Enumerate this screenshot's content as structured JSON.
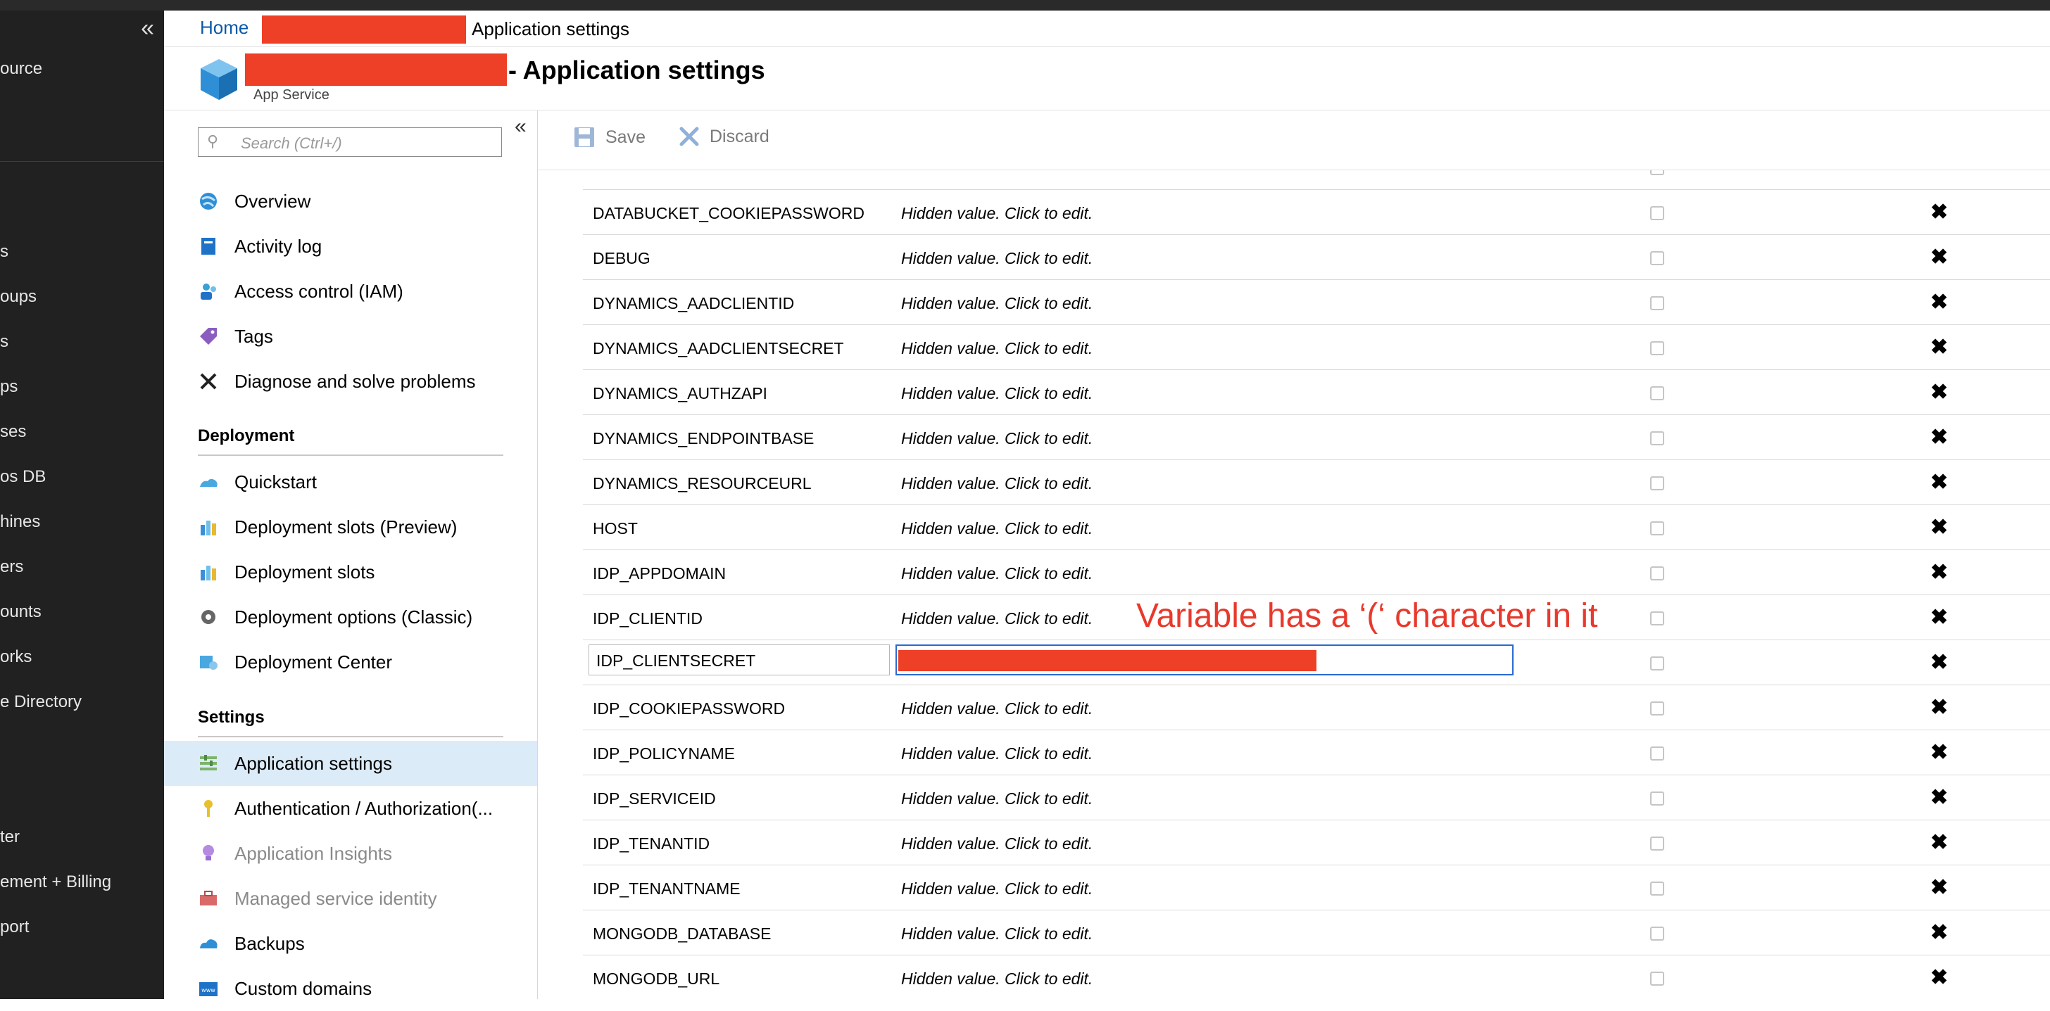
{
  "left_nav": {
    "items": [
      "ource",
      "s",
      "oups",
      "s",
      "ps",
      "ses",
      "os DB",
      "hines",
      "ers",
      "ounts",
      "orks",
      "e Directory",
      "ter",
      "ement + Billing",
      "port"
    ]
  },
  "breadcrumb": {
    "home": "Home",
    "current": "Application settings"
  },
  "header": {
    "title_suffix": "- Application settings",
    "subtitle": "App Service"
  },
  "search": {
    "placeholder": "Search (Ctrl+/)"
  },
  "menu": {
    "general": [
      {
        "label": "Overview",
        "icon": "overview-icon"
      },
      {
        "label": "Activity log",
        "icon": "activity-log-icon"
      },
      {
        "label": "Access control (IAM)",
        "icon": "iam-icon"
      },
      {
        "label": "Tags",
        "icon": "tag-icon"
      },
      {
        "label": "Diagnose and solve problems",
        "icon": "tools-icon"
      }
    ],
    "deployment_heading": "Deployment",
    "deployment": [
      {
        "label": "Quickstart",
        "icon": "quickstart-icon"
      },
      {
        "label": "Deployment slots (Preview)",
        "icon": "deployment-slots-icon"
      },
      {
        "label": "Deployment slots",
        "icon": "deployment-slots-icon"
      },
      {
        "label": "Deployment options (Classic)",
        "icon": "gear-icon"
      },
      {
        "label": "Deployment Center",
        "icon": "deployment-center-icon"
      }
    ],
    "settings_heading": "Settings",
    "settings": [
      {
        "label": "Application settings",
        "icon": "app-settings-icon",
        "active": true
      },
      {
        "label": "Authentication / Authorization(...",
        "icon": "key-icon"
      },
      {
        "label": "Application Insights",
        "icon": "insights-icon",
        "disabled": true
      },
      {
        "label": "Managed service identity",
        "icon": "toolbox-icon",
        "disabled": true
      },
      {
        "label": "Backups",
        "icon": "backup-cloud-icon"
      },
      {
        "label": "Custom domains",
        "icon": "www-icon"
      }
    ]
  },
  "toolbar": {
    "save": "Save",
    "discard": "Discard"
  },
  "settings_rows": [
    {
      "name": "DATABUCKET_COOKIEPASSWORD",
      "value": "Hidden value. Click to edit."
    },
    {
      "name": "DEBUG",
      "value": "Hidden value. Click to edit."
    },
    {
      "name": "DYNAMICS_AADCLIENTID",
      "value": "Hidden value. Click to edit."
    },
    {
      "name": "DYNAMICS_AADCLIENTSECRET",
      "value": "Hidden value. Click to edit."
    },
    {
      "name": "DYNAMICS_AUTHZAPI",
      "value": "Hidden value. Click to edit."
    },
    {
      "name": "DYNAMICS_ENDPOINTBASE",
      "value": "Hidden value. Click to edit."
    },
    {
      "name": "DYNAMICS_RESOURCEURL",
      "value": "Hidden value. Click to edit."
    },
    {
      "name": "HOST",
      "value": "Hidden value. Click to edit."
    },
    {
      "name": "IDP_APPDOMAIN",
      "value": "Hidden value. Click to edit."
    },
    {
      "name": "IDP_CLIENTID",
      "value": "Hidden value. Click to edit."
    },
    {
      "name": "IDP_CLIENTSECRET",
      "value": "",
      "editing": true
    },
    {
      "name": "IDP_COOKIEPASSWORD",
      "value": "Hidden value. Click to edit."
    },
    {
      "name": "IDP_POLICYNAME",
      "value": "Hidden value. Click to edit."
    },
    {
      "name": "IDP_SERVICEID",
      "value": "Hidden value. Click to edit."
    },
    {
      "name": "IDP_TENANTID",
      "value": "Hidden value. Click to edit."
    },
    {
      "name": "IDP_TENANTNAME",
      "value": "Hidden value. Click to edit."
    },
    {
      "name": "MONGODB_DATABASE",
      "value": "Hidden value. Click to edit."
    },
    {
      "name": "MONGODB_URL",
      "value": "Hidden value. Click to edit."
    }
  ],
  "annotation": "Variable has a ‘(‘ character in it",
  "colors": {
    "accent": "#0b59a8",
    "redaction": "#ee3f27",
    "annotation": "#e8392c",
    "active_bg": "#dcebf8"
  }
}
